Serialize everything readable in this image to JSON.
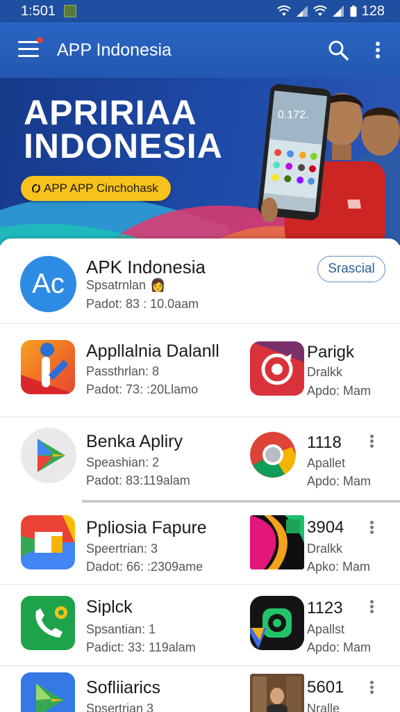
{
  "status_bar": {
    "time": "1:501",
    "battery": "128"
  },
  "app_bar": {
    "title": "APP Indonesia"
  },
  "banner": {
    "title_line1": "APRIRIAA",
    "title_line2": "INDONESIA",
    "chip_label": "APP APP Cinchohask",
    "phone_time": "0.172."
  },
  "featured": {
    "name": "APK Indonesia",
    "subtitle": "Spsatrnlan",
    "meta": "Padot: 83 : 10.0aam",
    "icon_text": "Ac",
    "button_label": "Srascial"
  },
  "rows": [
    {
      "left": {
        "name": "Appllalnia Dalanll",
        "sub": "Passthrlan: 8",
        "meta": "Padot: 73: :20Llamo"
      },
      "right": {
        "name": "Parigk",
        "sub": "Dralkk",
        "meta": "Apdo: Mam"
      }
    },
    {
      "left": {
        "name": "Benka Apliry",
        "sub": "Speashian: 2",
        "meta": "Padot: 83:119alam"
      },
      "right": {
        "name": "1118",
        "sub": "Apallet",
        "meta": "Apdo: Mam"
      }
    },
    {
      "left": {
        "name": "Ppliosia Fapure",
        "sub": "Speertrian: 3",
        "meta": "Dadot: 66: :2309ame"
      },
      "right": {
        "name": "3904",
        "sub": "Dralkk",
        "meta": "Apko: Mam"
      }
    },
    {
      "left": {
        "name": "Siplck",
        "sub": "Spsantian: 1",
        "meta": "Padict: 33: 119alam"
      },
      "right": {
        "name": "1123",
        "sub": "Apallst",
        "meta": "Apdo: Mam"
      }
    },
    {
      "left": {
        "name": "Sofliiarics",
        "sub": "Spsertrian 3",
        "meta": ""
      },
      "right": {
        "name": "5601",
        "sub": "Nralle",
        "meta": ""
      }
    }
  ],
  "colors": {
    "app_bar": "#2a66c4",
    "accent_yellow": "#f8c21c",
    "featured_icon": "#2d8be3"
  }
}
